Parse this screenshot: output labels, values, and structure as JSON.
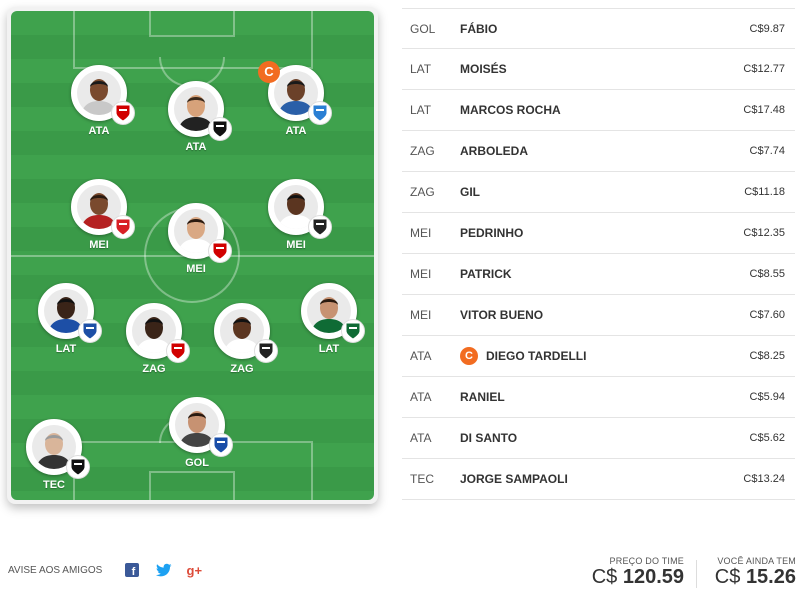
{
  "field": {
    "players": [
      {
        "pos": "ATA",
        "skin": "#7a4a2e",
        "hair": "#1a1a1a",
        "shirt": "#c8c8c8",
        "team": "sao-paulo-crest-icon",
        "team_color": "#d10000",
        "captain": false
      },
      {
        "pos": "ATA",
        "skin": "#d7a27a",
        "hair": "#3b2a1c",
        "shirt": "#222222",
        "team": "atletico-mg-crest-icon",
        "team_color": "#111111",
        "captain": false
      },
      {
        "pos": "ATA",
        "skin": "#6b4129",
        "hair": "#1a1a1a",
        "shirt": "#2a5fa8",
        "team": "gremio-crest-icon",
        "team_color": "#2a7fd4",
        "captain": true,
        "captain_label": "C"
      },
      {
        "pos": "MEI",
        "skin": "#7a4a2e",
        "hair": "#2a1a10",
        "shirt": "#b52020",
        "team": "internacional-crest-icon",
        "team_color": "#d81f26",
        "captain": false
      },
      {
        "pos": "MEI",
        "skin": "#d9a884",
        "hair": "#2a1a10",
        "shirt": "#ffffff",
        "team": "sao-paulo-crest-icon",
        "team_color": "#d10000",
        "captain": false
      },
      {
        "pos": "MEI",
        "skin": "#5b3520",
        "hair": "#111111",
        "shirt": "#ffffff",
        "team": "corinthians-crest-icon",
        "team_color": "#222222",
        "captain": false
      },
      {
        "pos": "LAT",
        "skin": "#3a2418",
        "hair": "#111111",
        "shirt": "#1d4fa6",
        "team": "bahia-crest-icon",
        "team_color": "#1d4fa6",
        "captain": false
      },
      {
        "pos": "ZAG",
        "skin": "#3a2418",
        "hair": "#111111",
        "shirt": "#ffffff",
        "team": "sao-paulo-crest-icon",
        "team_color": "#d10000",
        "captain": false
      },
      {
        "pos": "ZAG",
        "skin": "#5b3520",
        "hair": "#111111",
        "shirt": "#ffffff",
        "team": "corinthians-crest-icon",
        "team_color": "#222222",
        "captain": false
      },
      {
        "pos": "LAT",
        "skin": "#c79272",
        "hair": "#2a1a10",
        "shirt": "#0f6b35",
        "team": "palmeiras-crest-icon",
        "team_color": "#0f6b35",
        "captain": false
      },
      {
        "pos": "TEC",
        "skin": "#d9b59a",
        "hair": "#9a9a9a",
        "shirt": "#333333",
        "team": "santos-crest-icon",
        "team_color": "#111111",
        "captain": false
      },
      {
        "pos": "GOL",
        "skin": "#c79272",
        "hair": "#2a1a10",
        "shirt": "#444444",
        "team": "cruzeiro-crest-icon",
        "team_color": "#1a4ea8",
        "captain": false
      }
    ]
  },
  "list": [
    {
      "pos": "GOL",
      "name": "FÁBIO",
      "price": "C$9.87",
      "captain": false
    },
    {
      "pos": "LAT",
      "name": "MOISÉS",
      "price": "C$12.77",
      "captain": false
    },
    {
      "pos": "LAT",
      "name": "MARCOS ROCHA",
      "price": "C$17.48",
      "captain": false
    },
    {
      "pos": "ZAG",
      "name": "ARBOLEDA",
      "price": "C$7.74",
      "captain": false
    },
    {
      "pos": "ZAG",
      "name": "GIL",
      "price": "C$11.18",
      "captain": false
    },
    {
      "pos": "MEI",
      "name": "PEDRINHO",
      "price": "C$12.35",
      "captain": false
    },
    {
      "pos": "MEI",
      "name": "PATRICK",
      "price": "C$8.55",
      "captain": false
    },
    {
      "pos": "MEI",
      "name": "VITOR BUENO",
      "price": "C$7.60",
      "captain": false
    },
    {
      "pos": "ATA",
      "name": "DIEGO TARDELLI",
      "price": "C$8.25",
      "captain": true,
      "captain_label": "C"
    },
    {
      "pos": "ATA",
      "name": "RANIEL",
      "price": "C$5.94",
      "captain": false
    },
    {
      "pos": "ATA",
      "name": "DI SANTO",
      "price": "C$5.62",
      "captain": false
    },
    {
      "pos": "TEC",
      "name": "JORGE SAMPAOLI",
      "price": "C$13.24",
      "captain": false
    }
  ],
  "share": {
    "label": "AVISE AOS AMIGOS",
    "facebook": "f",
    "twitter": "t",
    "google": "g+",
    "facebook_color": "#3b5998",
    "twitter_color": "#1da1f2",
    "google_color": "#dd4b39"
  },
  "stats": {
    "team_price_label": "PREÇO DO TIME",
    "team_price_prefix": "C$",
    "team_price_value": "120.59",
    "remaining_label": "VOCÊ AINDA TEM",
    "remaining_prefix": "C$",
    "remaining_value": "15.26"
  }
}
